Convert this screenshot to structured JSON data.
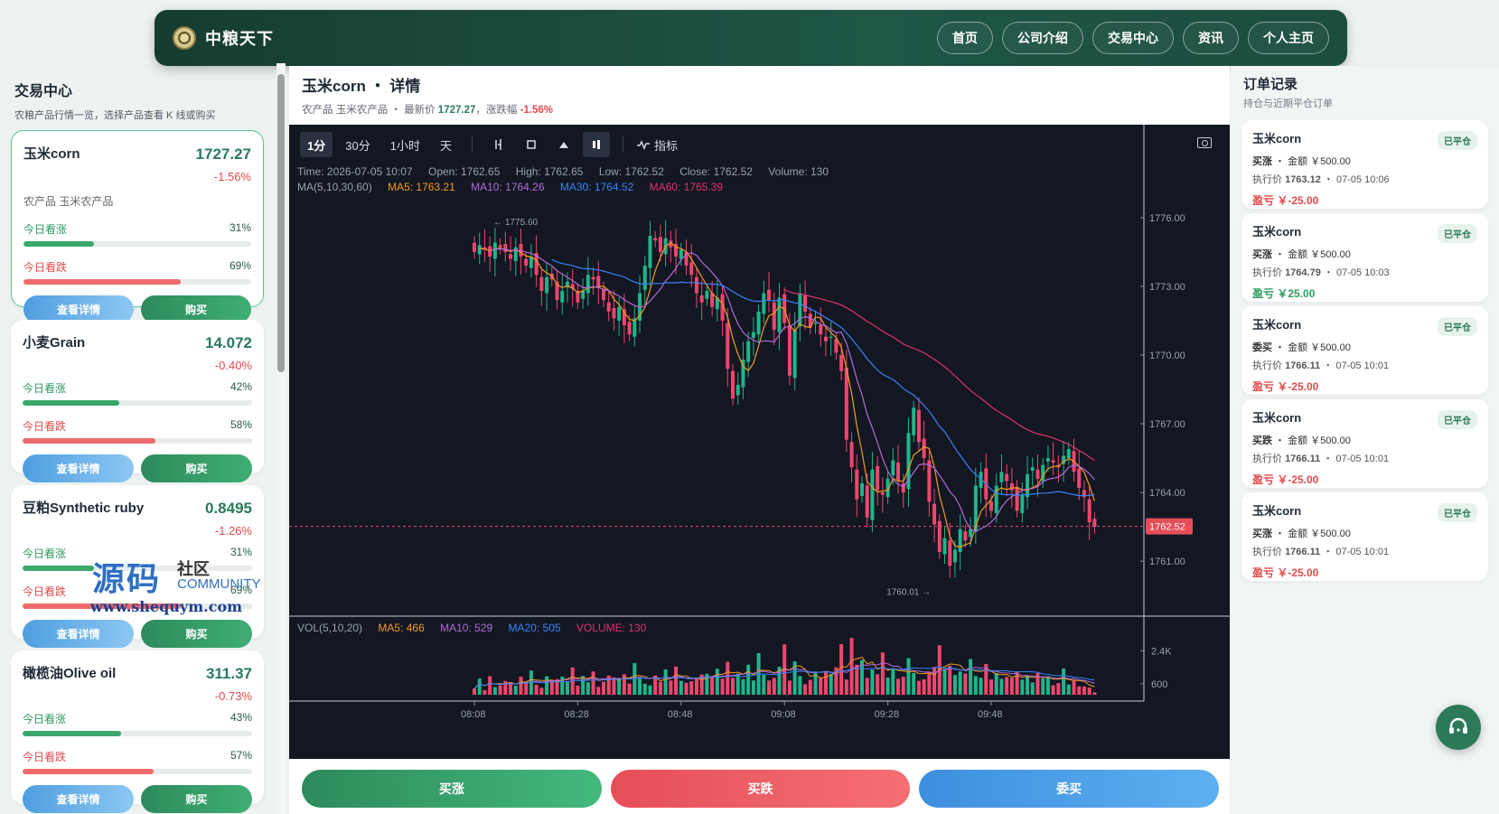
{
  "nav": {
    "brand": "中粮天下",
    "links": [
      "首页",
      "公司介绍",
      "交易中心",
      "资讯",
      "个人主页"
    ]
  },
  "left": {
    "title": "交易中心",
    "subtitle": "农粮产品行情一览，选择产品查看 K 线或购买",
    "detail_label": "查看详情",
    "buy_label": "购买",
    "up_label": "今日看涨",
    "down_label": "今日看跌",
    "products": [
      {
        "name": "玉米corn",
        "price": "1727.27",
        "change": "-1.56%",
        "tag": "农产品 玉米农产品",
        "up": "31%",
        "down": "69%",
        "up_frac": 0.31,
        "down_frac": 0.69
      },
      {
        "name": "小麦Grain",
        "price": "14.072",
        "change": "-0.40%",
        "tag": "",
        "up": "42%",
        "down": "58%",
        "up_frac": 0.42,
        "down_frac": 0.58
      },
      {
        "name": "豆粕Synthetic ruby",
        "price": "0.8495",
        "change": "-1.26%",
        "tag": "",
        "up": "31%",
        "down": "69%",
        "up_frac": 0.31,
        "down_frac": 0.69
      },
      {
        "name": "橄榄油Olive oil",
        "price": "311.37",
        "change": "-0.73%",
        "tag": "",
        "up": "43%",
        "down": "57%",
        "up_frac": 0.43,
        "down_frac": 0.57
      }
    ]
  },
  "watermark": {
    "big": "源码",
    "side": "社区",
    "community": "COMMUNITY",
    "url": "www.shequym.com"
  },
  "center": {
    "title": "玉米corn ・ 详情",
    "meta_prefix": "农产品 玉米农产品 ・ 最新价",
    "latest_price": "1727.27",
    "meta_mid": "，涨跌幅",
    "change": "-1.56%",
    "intervals": [
      "1分",
      "30分",
      "1小时",
      "天"
    ],
    "active_interval": "1分",
    "indicator_label": "指标",
    "info": {
      "time": "Time: 2026-07-05 10:07",
      "open": "Open: 1762.65",
      "high": "High: 1762.65",
      "low": "Low: 1762.52",
      "close": "Close: 1762.52",
      "volume": "Volume: 130"
    },
    "ma": {
      "label": "MA(5,10,30,60)",
      "ma5": "MA5: 1763.21",
      "ma10": "MA10: 1764.26",
      "ma30": "MA30: 1764.52",
      "ma60": "MA60: 1765.39"
    },
    "vol": {
      "label": "VOL(5,10,20)",
      "ma5": "MA5: 466",
      "ma10": "MA10: 529",
      "ma20": "MA20: 505",
      "volume": "VOLUME: 130"
    },
    "actions": {
      "up": "买涨",
      "down": "买跌",
      "entrust": "委买"
    }
  },
  "chart_data": {
    "type": "candlestick",
    "y_ticks": [
      "1776.00",
      "1773.00",
      "1770.00",
      "1767.00",
      "1764.00",
      "1761.00"
    ],
    "ylim": [
      1758.6,
      1778.4
    ],
    "x_ticks": [
      "08:08",
      "08:28",
      "08:48",
      "09:08",
      "09:28",
      "09:48"
    ],
    "vol_ticks": [
      "2.4K",
      "600"
    ],
    "last_price": "1762.52",
    "max_label": "1775.60",
    "min_label": "1760.01",
    "ma_colors": {
      "ma5": "#f59a23",
      "ma10": "#b36bd8",
      "ma30": "#3b82f6",
      "ma60": "#e0336e"
    },
    "up_color": "#1fb58a",
    "down_color": "#f0466e",
    "close": [
      1774.5,
      1774.8,
      1774.6,
      1774.3,
      1774.9,
      1774.7,
      1774.5,
      1774.2,
      1774.7,
      1774.3,
      1773.9,
      1774.3,
      1773.5,
      1772.8,
      1773.4,
      1773.3,
      1772.4,
      1772.8,
      1773.2,
      1772.9,
      1772.3,
      1772.8,
      1773.5,
      1773.3,
      1773.0,
      1772.4,
      1771.9,
      1771.6,
      1772.1,
      1771.3,
      1770.9,
      1771.6,
      1772.7,
      1773.9,
      1775.2,
      1775.0,
      1774.5,
      1775.1,
      1774.7,
      1774.3,
      1774.6,
      1773.9,
      1773.5,
      1772.7,
      1772.3,
      1772.8,
      1772.1,
      1772.5,
      1771.5,
      1769.4,
      1768.1,
      1768.7,
      1769.8,
      1770.6,
      1771.0,
      1771.9,
      1772.7,
      1772.4,
      1771.1,
      1772.5,
      1771.4,
      1769.1,
      1771.1,
      1772.7,
      1771.9,
      1771.2,
      1771.4,
      1770.9,
      1770.6,
      1770.8,
      1770.1,
      1769.3,
      1766.3,
      1765.1,
      1763.7,
      1764.4,
      1762.9,
      1765.0,
      1764.1,
      1763.9,
      1764.6,
      1765.4,
      1764.5,
      1764.0,
      1766.6,
      1767.7,
      1766.2,
      1765.5,
      1763.6,
      1762.6,
      1761.4,
      1762.0,
      1760.8,
      1761.5,
      1762.4,
      1761.9,
      1762.4,
      1764.3,
      1764.9,
      1763.7,
      1763.2,
      1764.3,
      1764.9,
      1764.5,
      1764.1,
      1763.2,
      1763.9,
      1764.8,
      1765.1,
      1764.6,
      1765.2,
      1765.5,
      1765.3,
      1765.1,
      1765.6,
      1765.9,
      1764.9,
      1764.2,
      1763.8,
      1762.7,
      1762.5
    ],
    "volume": [
      340,
      880,
      250,
      1010,
      420,
      520,
      750,
      680,
      490,
      980,
      660,
      1320,
      550,
      380,
      1010,
      780,
      850,
      990,
      720,
      1490,
      500,
      1020,
      680,
      1270,
      430,
      710,
      1050,
      950,
      840,
      1120,
      610,
      1730,
      910,
      600,
      510,
      1050,
      700,
      1380,
      780,
      1540,
      760,
      650,
      740,
      900,
      1100,
      1150,
      980,
      1420,
      880,
      1800,
      920,
      1150,
      850,
      1640,
      780,
      2270,
      1090,
      780,
      920,
      1530,
      2750,
      770,
      1820,
      1020,
      570,
      810,
      1200,
      950,
      1300,
      1140,
      1500,
      2760,
      830,
      3100,
      1640,
      1900,
      920,
      1380,
      1120,
      2310,
      940,
      1390,
      870,
      980,
      2000,
      1190,
      760,
      840,
      1180,
      1520,
      2700,
      1410,
      1580,
      1080,
      1270,
      1160,
      1950,
      1020,
      930,
      1680,
      830,
      1180,
      870,
      970,
      920,
      1240,
      820,
      1060,
      670,
      1180,
      880,
      1010,
      520,
      640,
      1430,
      560,
      770,
      460,
      450,
      390,
      130
    ]
  },
  "right": {
    "title": "订单记录",
    "subtitle": "持仓与近期平仓订单",
    "badge": "已平仓",
    "orders": [
      {
        "name": "玉米corn",
        "side": "买涨",
        "amount": "金额 ￥500.00",
        "exec": "执行价",
        "exec_price": "1763.12",
        "time": "07-05 10:06",
        "pnl": "盈亏 ￥-25.00",
        "pnl_type": "loss"
      },
      {
        "name": "玉米corn",
        "side": "买涨",
        "amount": "金额 ￥500.00",
        "exec": "执行价",
        "exec_price": "1764.79",
        "time": "07-05 10:03",
        "pnl": "盈亏 ￥25.00",
        "pnl_type": "gain"
      },
      {
        "name": "玉米corn",
        "side": "委买",
        "amount": "金额 ￥500.00",
        "exec": "执行价",
        "exec_price": "1766.11",
        "time": "07-05 10:01",
        "pnl": "盈亏 ￥-25.00",
        "pnl_type": "loss"
      },
      {
        "name": "玉米corn",
        "side": "买跌",
        "amount": "金额 ￥500.00",
        "exec": "执行价",
        "exec_price": "1766.11",
        "time": "07-05 10:01",
        "pnl": "盈亏 ￥-25.00",
        "pnl_type": "loss"
      },
      {
        "name": "玉米corn",
        "side": "买涨",
        "amount": "金额 ￥500.00",
        "exec": "执行价",
        "exec_price": "1766.11",
        "time": "07-05 10:01",
        "pnl": "盈亏 ￥-25.00",
        "pnl_type": "loss"
      }
    ]
  }
}
